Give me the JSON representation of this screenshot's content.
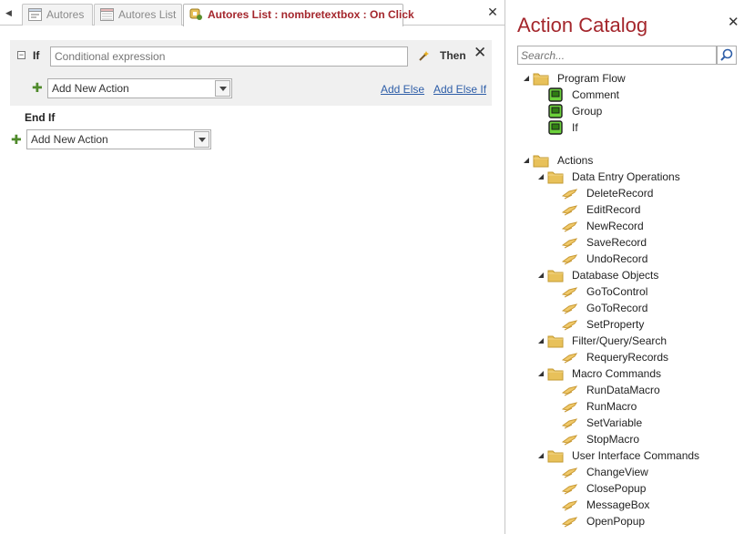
{
  "tabs": [
    {
      "label": "Autores",
      "active": false,
      "icon": "form-icon"
    },
    {
      "label": "Autores List",
      "active": false,
      "icon": "list-form-icon"
    },
    {
      "label": "Autores List : nombretextbox : On Click",
      "active": true,
      "icon": "embedded-macro-icon"
    }
  ],
  "if_block": {
    "keyword": "If",
    "condition_placeholder": "Conditional expression",
    "then_keyword": "Then",
    "add_action_label": "Add New Action",
    "add_else": "Add Else",
    "add_else_if": "Add Else If"
  },
  "end_if": "End If",
  "outer_add_action_label": "Add New Action",
  "catalog": {
    "title": "Action Catalog",
    "search_placeholder": "Search...",
    "program_flow": {
      "label": "Program Flow",
      "items": [
        "Comment",
        "Group",
        "If"
      ]
    },
    "actions": {
      "label": "Actions",
      "groups": [
        {
          "label": "Data Entry Operations",
          "items": [
            "DeleteRecord",
            "EditRecord",
            "NewRecord",
            "SaveRecord",
            "UndoRecord"
          ]
        },
        {
          "label": "Database Objects",
          "items": [
            "GoToControl",
            "GoToRecord",
            "SetProperty"
          ]
        },
        {
          "label": "Filter/Query/Search",
          "items": [
            "RequeryRecords"
          ]
        },
        {
          "label": "Macro Commands",
          "items": [
            "RunDataMacro",
            "RunMacro",
            "SetVariable",
            "StopMacro"
          ]
        },
        {
          "label": "User Interface Commands",
          "items": [
            "ChangeView",
            "ClosePopup",
            "MessageBox",
            "OpenPopup"
          ]
        }
      ]
    }
  },
  "colors": {
    "accent": "#a4262c",
    "link": "#2e5ea8",
    "if_block_bg": "#f0f0f0",
    "plus_green": "#4f8a2b",
    "folder": "#e8c15a"
  }
}
